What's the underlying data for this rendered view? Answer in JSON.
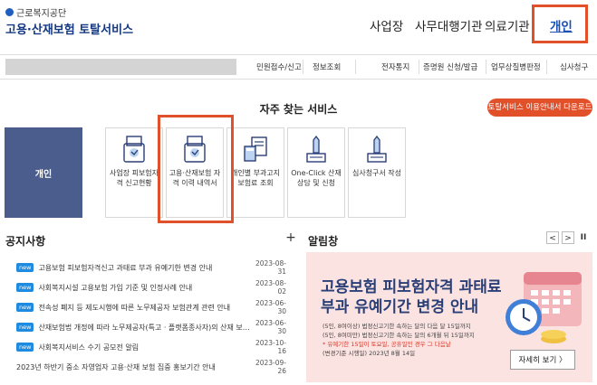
{
  "header": {
    "org": "근로복지공단",
    "title": "고용·산재보험 토탈서비스",
    "nav": [
      "사업장",
      "사무대행기관",
      "의료기관",
      "개인"
    ],
    "active_nav": "개인"
  },
  "submenu": [
    "민원접수/신고",
    "정보조회",
    "전자통지",
    "증명원 신청/발급",
    "업무상질병판정",
    "심사청구"
  ],
  "favorites": {
    "title": "자주 찾는 서비스",
    "guide_button": "토탈서비스 이용안내서 다운로드",
    "person_tile": "개인",
    "tiles": [
      {
        "icon": "document-check-icon",
        "label": "사업장 피보험자격 신고현황"
      },
      {
        "icon": "document-check-icon",
        "label": "고용·산재보험 자격 이력 내역서"
      },
      {
        "icon": "calculator-document-icon",
        "label": "개인별 부과고지보험료 조회"
      },
      {
        "icon": "pen-document-icon",
        "label": "One-Click 산재상담 및 신청"
      },
      {
        "icon": "pen-document-icon",
        "label": "심사청구서 작성"
      }
    ]
  },
  "notices": {
    "title": "공지사항",
    "more": "+",
    "items": [
      {
        "badge": "new",
        "text": "고용보험 피보험자격신고 과태료 부과 유예기한 변경 안내",
        "date": "2023-08-31"
      },
      {
        "badge": "new",
        "text": "사회복지시설 고용보험 가입 기준 및 인정사례 안내",
        "date": "2023-08-02"
      },
      {
        "badge": "new",
        "text": "전속성 폐지 등 제도시행에 따른 노무제공자 보험관계 관련 안내",
        "date": "2023-06-30"
      },
      {
        "badge": "new",
        "text": "산재보험법 개정에 따라 노무제공자(특고 · 플랫폼종사자)의 산재 보; ...",
        "date": "2023-06-30"
      },
      {
        "badge": "new",
        "text": "사회복지서비스 수기 공모전 알림",
        "date": "2023-10-16"
      },
      {
        "badge": "",
        "text": "2023년 하반기 중소 자영업자 고용·산재 보험 집중 홍보기간 안내",
        "date": "2023-09-26"
      }
    ]
  },
  "alarm": {
    "title": "알림창",
    "prev": "<",
    "next": ">",
    "pause": "II",
    "banner": {
      "line1": "고용보험 피보험자격 과태료",
      "line2": "부과 유예기간 변경 안내",
      "detail1": "(5인, 8여이상) 법정신고기한 속하는 달의 다음 달 15일까지",
      "detail2": "(5인, 8여미만) 법정신고기한 속하는 달의 6개월 뒤 15일까지",
      "detail3": "* 유예기한 15일이 토요일, 공휴일인 경우 그 다음날",
      "detail4": "(변경기준 시행일) 2023년 8월 14일",
      "more": "자세히 보기  〉"
    }
  },
  "colors": {
    "accent": "#e2502a",
    "navy": "#2b3f77",
    "badge": "#1f8be0",
    "person_tile": "#4a5d8c",
    "banner_bg": "#fbe3e1"
  }
}
